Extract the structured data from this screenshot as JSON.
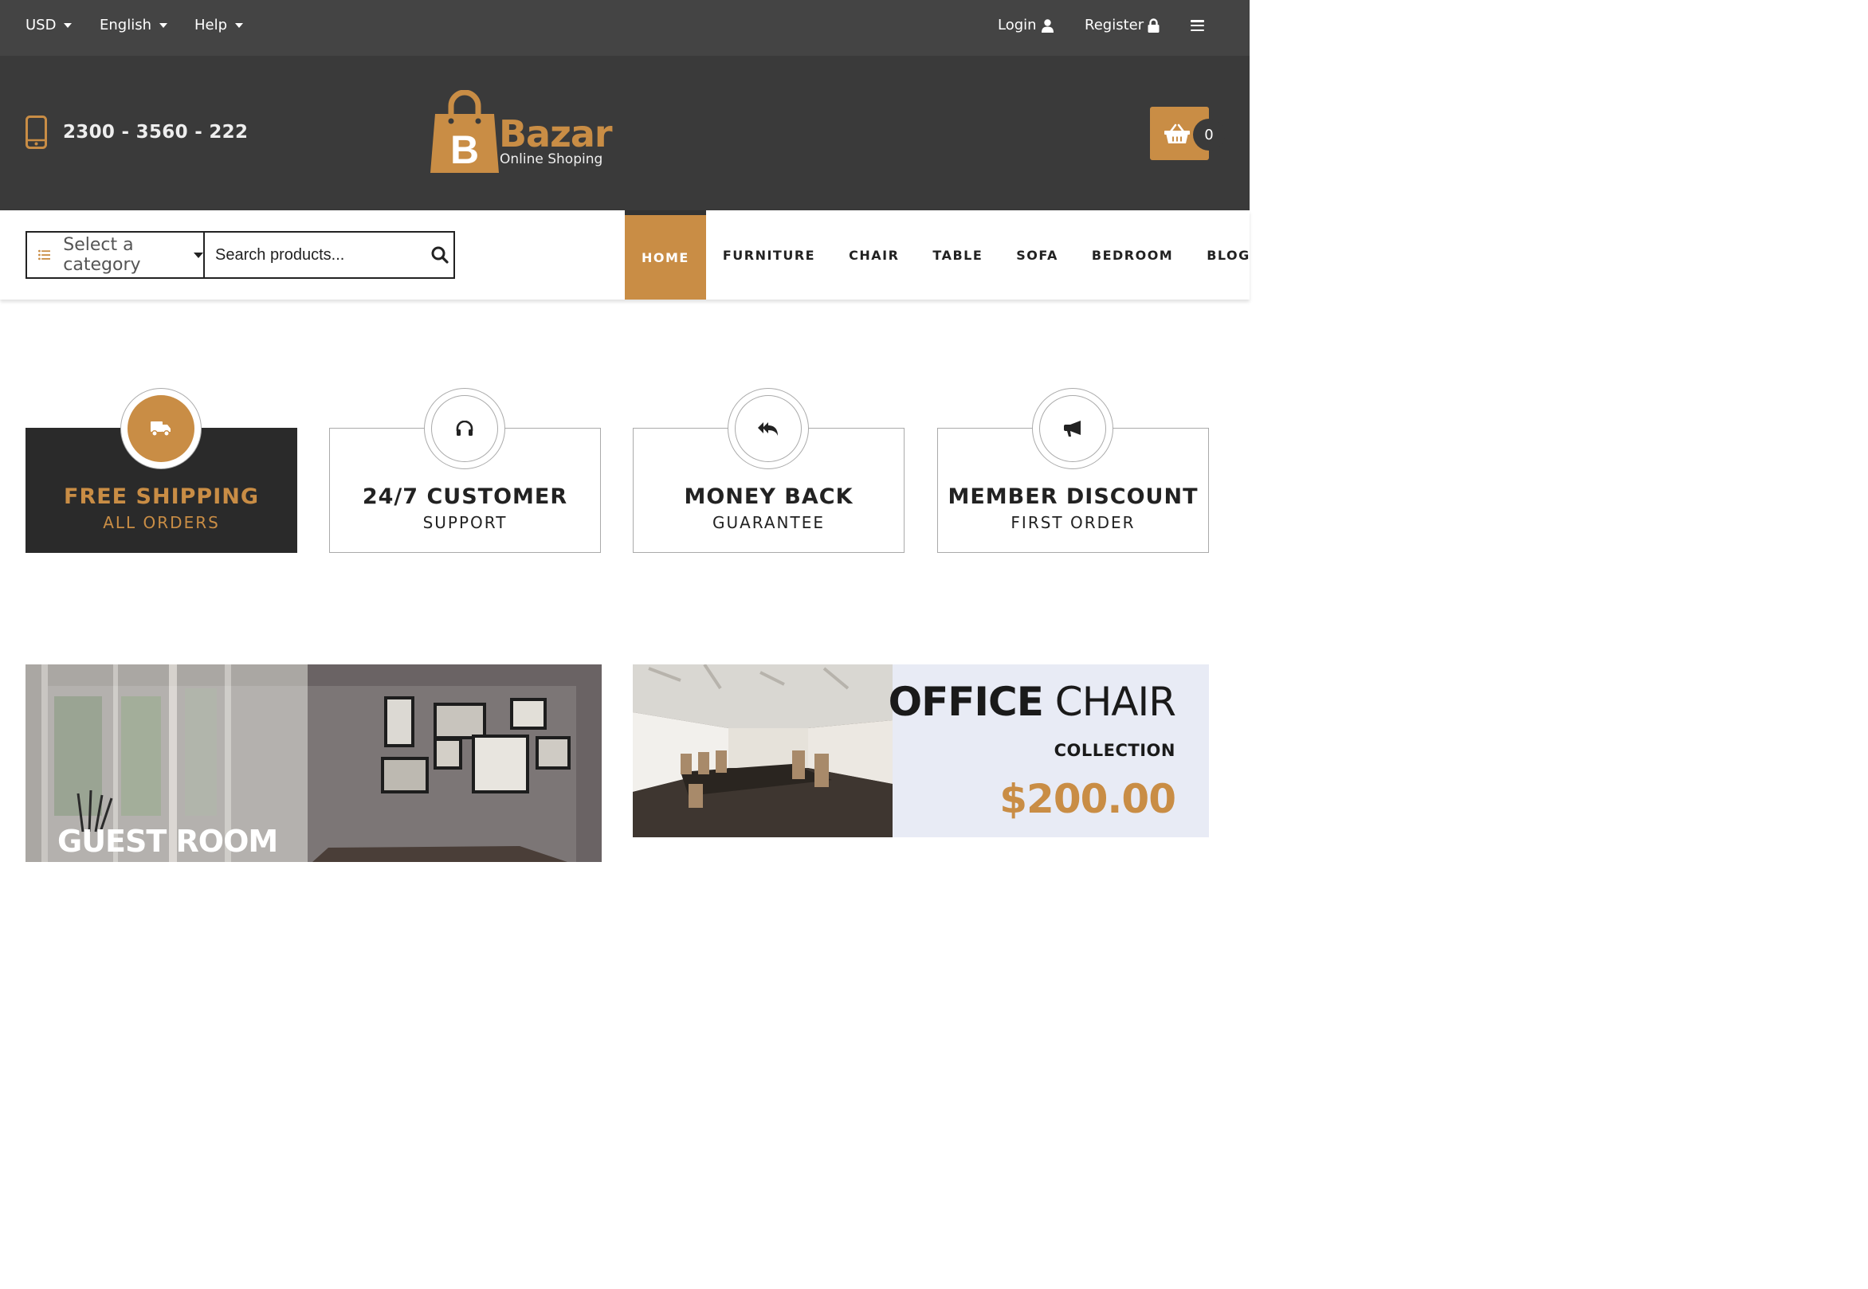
{
  "topbar": {
    "currency": "USD",
    "language": "English",
    "help": "Help",
    "login": "Login",
    "register": "Register"
  },
  "header": {
    "phone": "2300 - 3560 - 222",
    "logo_letter": "B",
    "logo_name": "Bazar",
    "logo_tagline": "Online Shoping",
    "cart_count": "0"
  },
  "search": {
    "category_label": "Select a category",
    "placeholder": "Search products..."
  },
  "nav": {
    "items": [
      "HOME",
      "FURNITURE",
      "CHAIR",
      "TABLE",
      "SOFA",
      "BEDROOM",
      "BLOG"
    ],
    "active": "HOME"
  },
  "features": [
    {
      "title": "FREE SHIPPING",
      "subtitle": "ALL ORDERS",
      "icon": "truck-icon"
    },
    {
      "title": "24/7 CUSTOMER",
      "subtitle": "SUPPORT",
      "icon": "headphones-icon"
    },
    {
      "title": "MONEY BACK",
      "subtitle": "GUARANTEE",
      "icon": "reply-all-icon"
    },
    {
      "title": "MEMBER DISCOUNT",
      "subtitle": "FIRST ORDER",
      "icon": "megaphone-icon"
    }
  ],
  "banners": {
    "guest_room": "GUEST ROOM",
    "office_title_bold": "OFFICE",
    "office_title_light": "CHAIR",
    "office_subtitle": "COLLECTION",
    "office_price": "$200.00"
  },
  "colors": {
    "accent": "#c98d45",
    "topbar_bg": "#444444",
    "header_bg": "#3a3a3a",
    "dark_card": "#2a2a2a"
  }
}
